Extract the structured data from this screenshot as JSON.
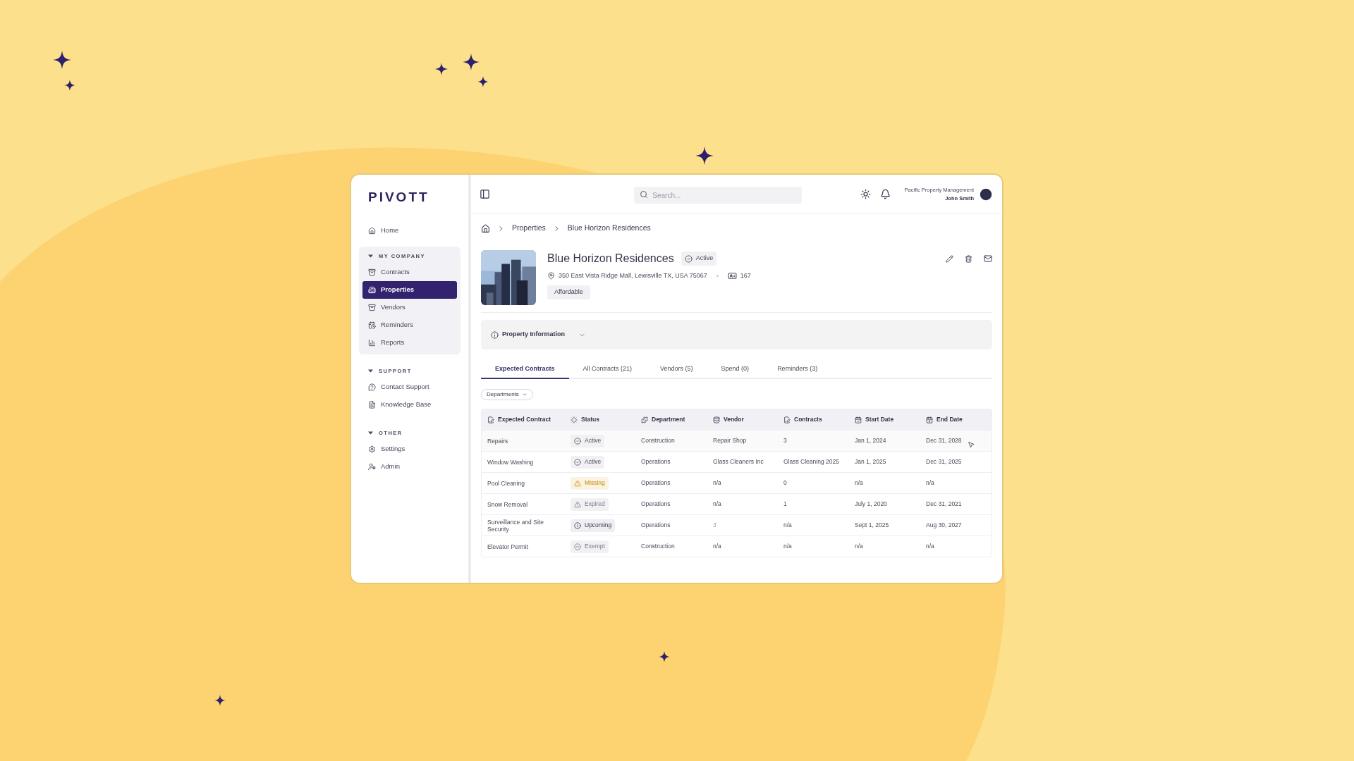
{
  "sidebar": {
    "logo": "PIVOTT",
    "top_items": [
      {
        "label": "Home",
        "selected": false
      }
    ],
    "sections": [
      {
        "title": "MY COMPANY",
        "expanded": true,
        "items": [
          {
            "label": "Contracts",
            "selected": false
          },
          {
            "label": "Properties",
            "selected": true
          },
          {
            "label": "Vendors",
            "selected": false
          },
          {
            "label": "Reminders",
            "selected": false
          },
          {
            "label": "Reports",
            "selected": false
          }
        ]
      },
      {
        "title": "SUPPORT",
        "expanded": true,
        "items": [
          {
            "label": "Contact Support",
            "selected": false
          },
          {
            "label": "Knowledge Base",
            "selected": false
          }
        ]
      },
      {
        "title": "OTHER",
        "expanded": true,
        "items": [
          {
            "label": "Settings",
            "selected": false
          },
          {
            "label": "Admin",
            "selected": false
          }
        ]
      }
    ]
  },
  "top_bar": {
    "search": {
      "placeholder": "Search..."
    },
    "organization": "Pacific Property Management",
    "user": "John Smith"
  },
  "breadcrumb": [
    "Properties",
    "Blue Horizon Residences"
  ],
  "property": {
    "name": "Blue Horizon Residences",
    "status": "Active",
    "address": "350 East Vista Ridge Mall, Lewisville TX, USA 75067",
    "units": "167",
    "tag": "Affordable"
  },
  "property_information": {
    "label": "Property Information",
    "expanded": false
  },
  "tabs": [
    {
      "label": "Expected Contracts",
      "selected": true
    },
    {
      "label": "All Contracts (21)",
      "selected": false
    },
    {
      "label": "Vendors (5)",
      "selected": false
    },
    {
      "label": "Spend (0)",
      "selected": false
    },
    {
      "label": "Reminders (3)",
      "selected": false
    }
  ],
  "filter": {
    "label": "Departments"
  },
  "table": {
    "columns": [
      "Expected Contract",
      "Status",
      "Department",
      "Vendor",
      "Contracts",
      "Start Date",
      "End Date"
    ],
    "rows": [
      {
        "name": "Repairs",
        "status": {
          "kind": "active",
          "label": "Active"
        },
        "department": "Construction",
        "vendor": "Repair Shop",
        "vendor_italic": false,
        "contracts": "3",
        "start": "Jan 1, 2024",
        "end": "Dec 31, 2028",
        "hovered": true
      },
      {
        "name": "Window Washing",
        "status": {
          "kind": "active",
          "label": "Active"
        },
        "department": "Operations",
        "vendor": "Glass Cleaners Inc",
        "vendor_italic": false,
        "contracts": "Glass Cleaning 2025",
        "start": "Jan 1, 2025",
        "end": "Dec 31, 2025",
        "hovered": false
      },
      {
        "name": "Pool Cleaning",
        "status": {
          "kind": "missing",
          "label": "Missing"
        },
        "department": "Operations",
        "vendor": "n/a",
        "vendor_italic": false,
        "contracts": "0",
        "start": "n/a",
        "end": "n/a",
        "hovered": false
      },
      {
        "name": "Snow Removal",
        "status": {
          "kind": "expired",
          "label": "Expired"
        },
        "department": "Operations",
        "vendor": "n/a",
        "vendor_italic": false,
        "contracts": "1",
        "start": "July 1, 2020",
        "end": "Dec 31, 2021",
        "hovered": false
      },
      {
        "name": "Surveillance and Site Security",
        "status": {
          "kind": "upcoming",
          "label": "Upcoming"
        },
        "department": "Operations",
        "vendor": "3",
        "vendor_italic": true,
        "contracts": "n/a",
        "start": "Sept 1, 2025",
        "end": "Aug 30, 2027",
        "hovered": false
      },
      {
        "name": "Elevator Permit",
        "status": {
          "kind": "exempt",
          "label": "Exempt"
        },
        "department": "Construction",
        "vendor": "n/a",
        "vendor_italic": false,
        "contracts": "n/a",
        "start": "n/a",
        "end": "n/a",
        "hovered": false
      }
    ]
  }
}
